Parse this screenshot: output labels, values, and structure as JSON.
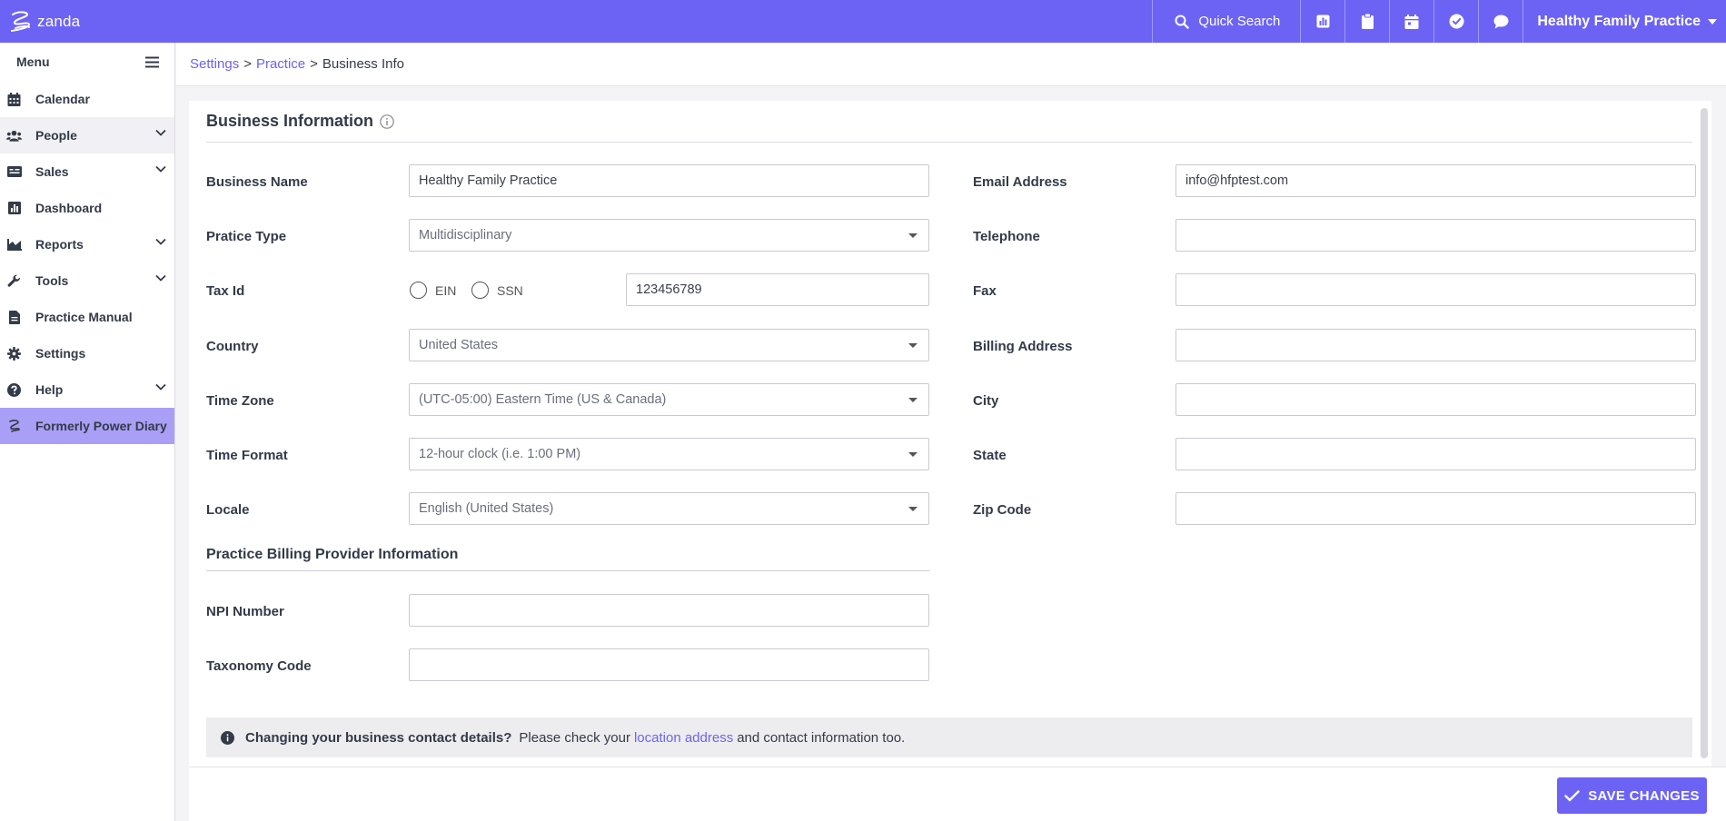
{
  "app": {
    "logo_text": "zanda",
    "quick_search_label": "Quick Search",
    "practice_name": "Healthy Family Practice",
    "brand_color": "#6c63f5",
    "top_icons": [
      "bar-chart-icon",
      "clipboard-icon",
      "calendar-icon",
      "check-circle-icon",
      "chat-icon"
    ]
  },
  "sidebar": {
    "menu_label": "Menu",
    "items": [
      {
        "label": "Calendar",
        "icon": "calendar-icon"
      },
      {
        "label": "People",
        "icon": "people-icon",
        "expandable": true
      },
      {
        "label": "Sales",
        "icon": "sales-icon",
        "expandable": true
      },
      {
        "label": "Dashboard",
        "icon": "dashboard-icon"
      },
      {
        "label": "Reports",
        "icon": "reports-icon",
        "expandable": true
      },
      {
        "label": "Tools",
        "icon": "wrench-icon",
        "expandable": true
      },
      {
        "label": "Practice Manual",
        "icon": "document-icon"
      },
      {
        "label": "Settings",
        "icon": "gear-icon"
      },
      {
        "label": "Help",
        "icon": "help-icon",
        "expandable": true
      },
      {
        "label": "Formerly Power Diary",
        "icon": "power-diary-icon"
      }
    ]
  },
  "breadcrumb": {
    "items": [
      "Settings",
      "Practice",
      "Business Info"
    ],
    "separator": ">"
  },
  "form": {
    "title": "Business Information",
    "business_name": {
      "label": "Business Name",
      "value": "Healthy Family Practice"
    },
    "practice_type": {
      "label": "Pratice Type",
      "value": "Multidisciplinary"
    },
    "tax_id": {
      "label": "Tax Id",
      "option_ein": "EIN",
      "option_ssn": "SSN",
      "value": "123456789"
    },
    "country": {
      "label": "Country",
      "value": "United States"
    },
    "time_zone": {
      "label": "Time Zone",
      "value": "(UTC-05:00) Eastern Time (US & Canada)"
    },
    "time_format": {
      "label": "Time Format",
      "value": "12-hour clock (i.e. 1:00 PM)"
    },
    "locale": {
      "label": "Locale",
      "value": "English (United States)"
    },
    "email": {
      "label": "Email Address",
      "value": "info@hfptest.com"
    },
    "telephone": {
      "label": "Telephone",
      "value": ""
    },
    "fax": {
      "label": "Fax",
      "value": ""
    },
    "billing_address": {
      "label": "Billing Address",
      "value": ""
    },
    "city": {
      "label": "City",
      "value": ""
    },
    "state": {
      "label": "State",
      "value": ""
    },
    "zip": {
      "label": "Zip Code",
      "value": ""
    },
    "billing_section_title": "Practice Billing Provider Information",
    "npi": {
      "label": "NPI Number",
      "value": ""
    },
    "taxonomy": {
      "label": "Taxonomy Code",
      "value": ""
    }
  },
  "notice": {
    "strong": "Changing your business contact details?",
    "text_before": "Please check your",
    "link": "location address",
    "text_after": "and contact information too."
  },
  "footer": {
    "save_label": "SAVE CHANGES"
  }
}
